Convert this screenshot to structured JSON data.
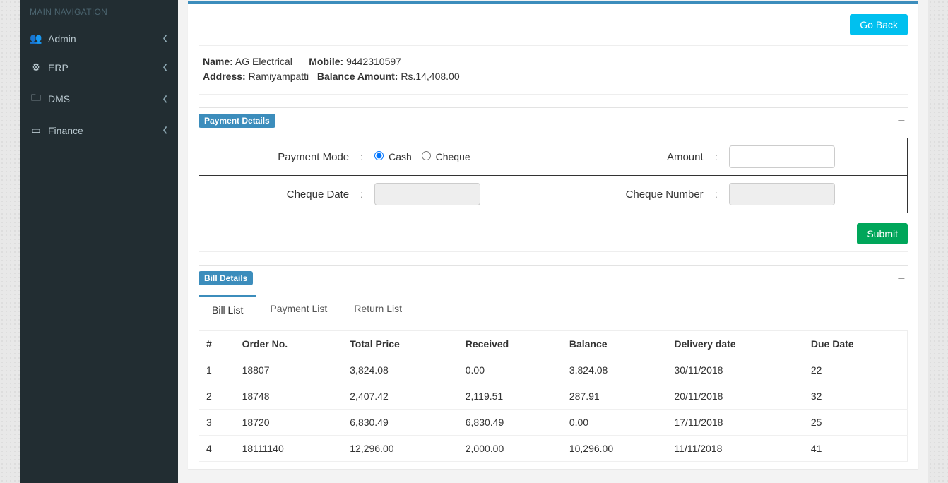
{
  "sidebar": {
    "header": "MAIN NAVIGATION",
    "items": [
      {
        "label": "Admin",
        "icon": "👥"
      },
      {
        "label": "ERP",
        "icon": "⚙"
      },
      {
        "label": "DMS",
        "icon": "🗀"
      },
      {
        "label": "Finance",
        "icon": "▭"
      }
    ]
  },
  "buttons": {
    "goBack": "Go Back",
    "submit": "Submit"
  },
  "customer": {
    "nameLabel": "Name:",
    "name": "AG Electrical",
    "mobileLabel": "Mobile:",
    "mobile": "9442310597",
    "addressLabel": "Address:",
    "address": "Ramiyampatti",
    "balanceLabel": "Balance Amount:",
    "balance": "Rs.14,408.00"
  },
  "payment": {
    "sectionTitle": "Payment Details",
    "modeLabel": "Payment Mode",
    "cashLabel": "Cash",
    "chequeLabel": "Cheque",
    "amountLabel": "Amount",
    "chequeDateLabel": "Cheque Date",
    "chequeNumberLabel": "Cheque Number"
  },
  "bill": {
    "sectionTitle": "Bill Details",
    "tabs": [
      "Bill List",
      "Payment List",
      "Return List"
    ],
    "columns": [
      "#",
      "Order No.",
      "Total Price",
      "Received",
      "Balance",
      "Delivery date",
      "Due Date"
    ],
    "rows": [
      {
        "n": "1",
        "order": "18807",
        "total": "3,824.08",
        "recv": "0.00",
        "bal": "3,824.08",
        "deliv": "30/11/2018",
        "due": "22"
      },
      {
        "n": "2",
        "order": "18748",
        "total": "2,407.42",
        "recv": "2,119.51",
        "bal": "287.91",
        "deliv": "20/11/2018",
        "due": "32"
      },
      {
        "n": "3",
        "order": "18720",
        "total": "6,830.49",
        "recv": "6,830.49",
        "bal": "0.00",
        "deliv": "17/11/2018",
        "due": "25"
      },
      {
        "n": "4",
        "order": "18111140",
        "total": "12,296.00",
        "recv": "2,000.00",
        "bal": "10,296.00",
        "deliv": "11/11/2018",
        "due": "41"
      }
    ]
  }
}
